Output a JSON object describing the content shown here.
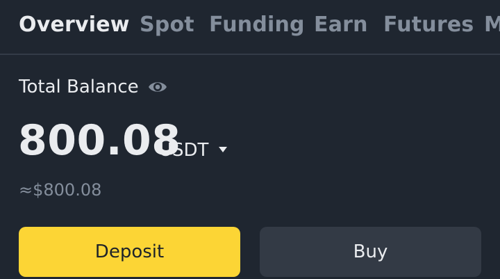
{
  "tabs": [
    {
      "label": "Overview",
      "active": true
    },
    {
      "label": "Spot",
      "active": false
    },
    {
      "label": "Funding",
      "active": false
    },
    {
      "label": "Earn",
      "active": false
    },
    {
      "label": "Futures",
      "active": false
    },
    {
      "label": "M",
      "active": false
    }
  ],
  "balance": {
    "label": "Total Balance",
    "value": "800.08",
    "currency": "USDT",
    "fiat_equivalent": "≈$800.08"
  },
  "actions": {
    "deposit_label": "Deposit",
    "buy_label": "Buy"
  },
  "icons": {
    "visibility": "eye-icon",
    "currency_dropdown": "caret-down-icon"
  },
  "colors": {
    "background": "#1f2630",
    "primary_text": "#eaecef",
    "secondary_text": "#848e9c",
    "accent": "#fcd535",
    "secondary_button": "#333a45"
  }
}
